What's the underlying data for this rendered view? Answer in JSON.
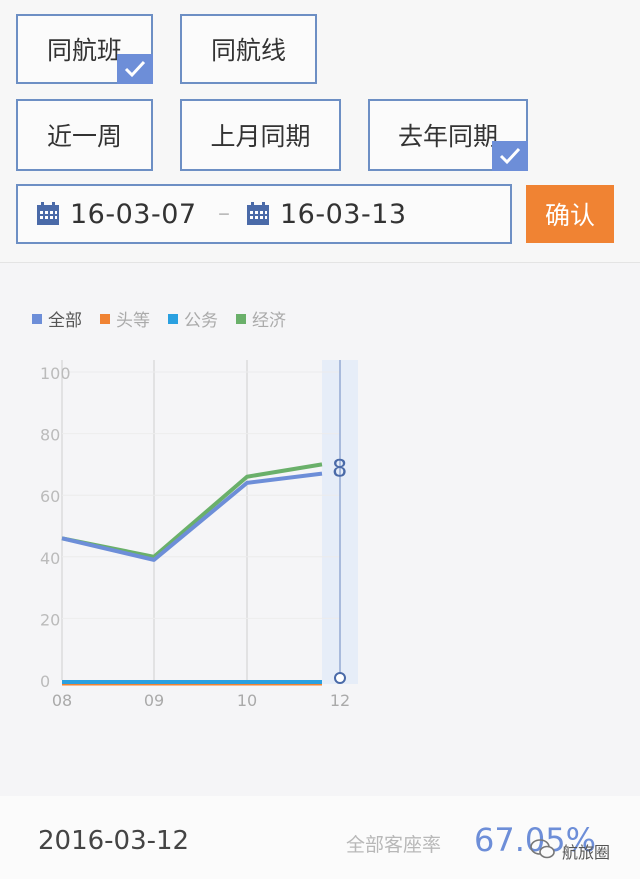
{
  "filters": {
    "route_type": [
      {
        "label": "同航班",
        "checked": true
      },
      {
        "label": "同航线",
        "checked": false
      }
    ],
    "compare": [
      {
        "label": "近一周",
        "checked": false
      },
      {
        "label": "上月同期",
        "checked": false
      },
      {
        "label": "去年同期",
        "checked": true
      }
    ]
  },
  "date_range": {
    "start": "16-03-07",
    "separator": "–",
    "end": "16-03-13",
    "icon": "calendar-icon"
  },
  "confirm_label": "确认",
  "colors": {
    "accent": "#6d8ed8",
    "confirm": "#f08333",
    "all": "#6d8ed8",
    "first": "#f08333",
    "business": "#2aa0e0",
    "economy": "#6ab06a"
  },
  "chart_data": {
    "type": "line",
    "x": [
      "08",
      "09",
      "10",
      "12"
    ],
    "ylim": [
      0,
      100
    ],
    "yticks": [
      "100",
      "80",
      "60",
      "40",
      "20",
      "0"
    ],
    "legend": [
      {
        "name": "全部",
        "color": "#6d8ed8"
      },
      {
        "name": "头等",
        "color": "#f08333"
      },
      {
        "name": "公务",
        "color": "#2aa0e0"
      },
      {
        "name": "经济",
        "color": "#6ab06a"
      }
    ],
    "series": [
      {
        "name": "全部",
        "values": [
          46,
          39,
          64,
          67
        ],
        "color": "#6d8ed8"
      },
      {
        "name": "头等",
        "values": [
          0,
          0,
          0,
          0
        ],
        "color": "#f08333"
      },
      {
        "name": "公务",
        "values": [
          0,
          0,
          0,
          0
        ],
        "color": "#2aa0e0"
      },
      {
        "name": "经济",
        "values": [
          46,
          40,
          66,
          70
        ],
        "color": "#6ab06a"
      }
    ],
    "highlight_index": 3,
    "highlight_label": "8",
    "grid": true
  },
  "footer": {
    "date": "2016-03-12",
    "metric_label": "全部客座率",
    "metric_value": "67.05%"
  },
  "watermark": {
    "text": "航旅圈",
    "icon": "wechat-icon"
  }
}
